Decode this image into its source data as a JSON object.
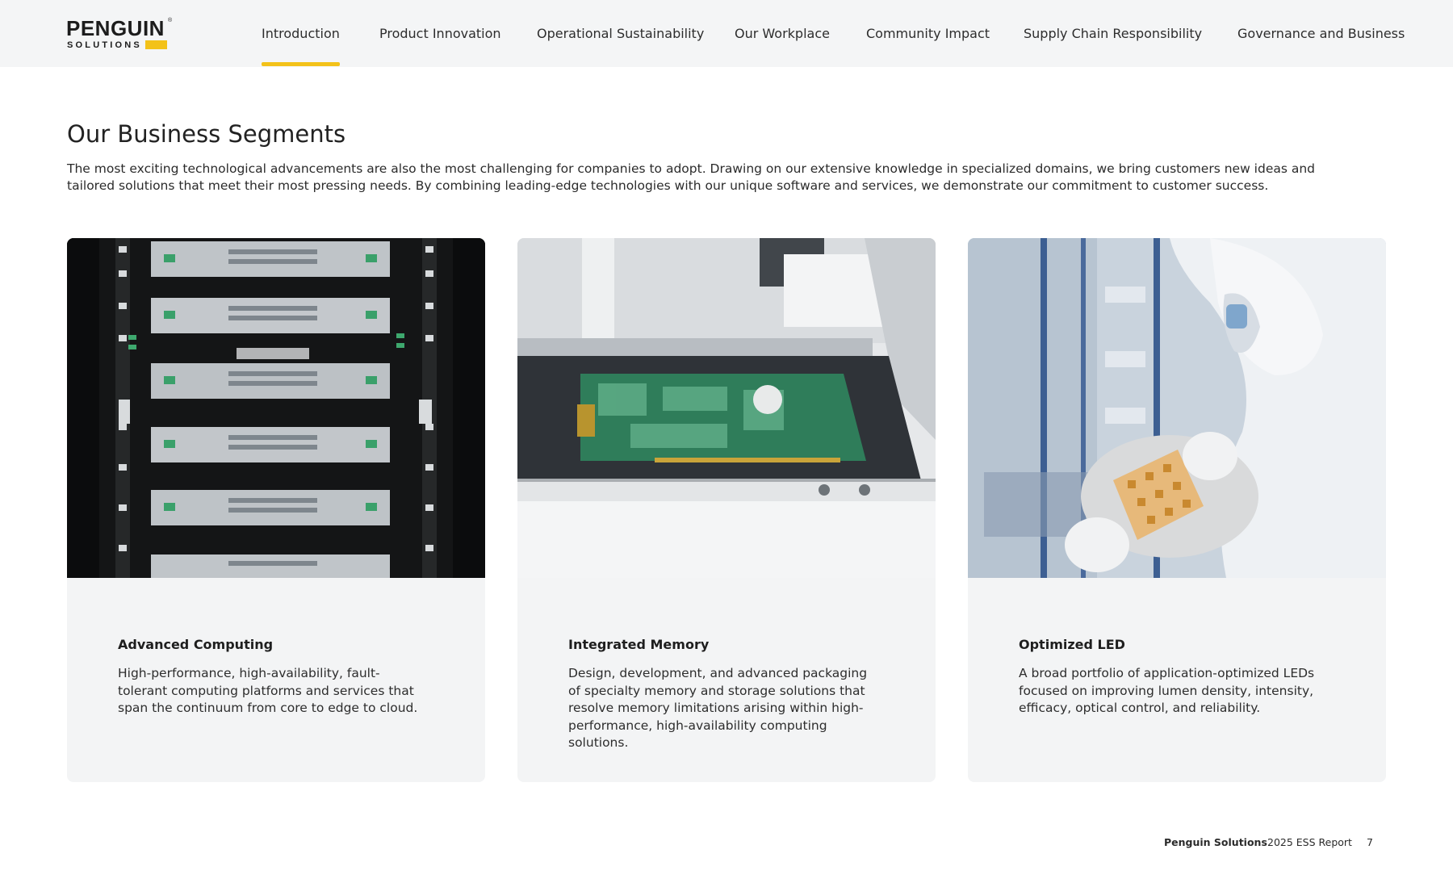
{
  "logo": {
    "word": "PENGUIN",
    "sub": "SOLUTIONS",
    "tm": "®",
    "accent_color": "#f3c219"
  },
  "nav": {
    "active_index": 0,
    "items": [
      {
        "label": "Introduction"
      },
      {
        "label": "Product Innovation"
      },
      {
        "label": "Operational Sustainability"
      },
      {
        "label": "Our Workplace"
      },
      {
        "label": "Community Impact"
      },
      {
        "label": "Supply Chain Responsibility"
      },
      {
        "label": "Governance and Business"
      }
    ]
  },
  "page": {
    "title": "Our Business Segments",
    "intro": "The most exciting technological advancements are also the most challenging for companies to adopt. Drawing on our extensive knowledge in specialized domains, we bring customers new ideas and tailored solutions that meet their most pressing needs. By combining leading-edge technologies with our unique software and services, we demonstrate our commitment to customer success."
  },
  "cards": [
    {
      "image": "server-rack-photo",
      "title": "Advanced Computing",
      "text": "High-performance, high-availability, fault-tolerant computing platforms and services that span the continuum from core to edge to cloud."
    },
    {
      "image": "memory-circuit-board-photo",
      "title": "Integrated Memory",
      "text": "Design, development, and advanced packaging of specialty memory and storage solutions that resolve memory limitations arising within high-performance, high-availability computing solutions."
    },
    {
      "image": "cleanroom-led-wafer-photo",
      "title": "Optimized LED",
      "text": "A broad portfolio of application-optimized LEDs focused on improving lumen density, intensity, efficacy, optical control, and reliability."
    }
  ],
  "footer": {
    "brand": "Penguin Solutions",
    "report": "2025 ESS Report",
    "page_number": "7"
  }
}
